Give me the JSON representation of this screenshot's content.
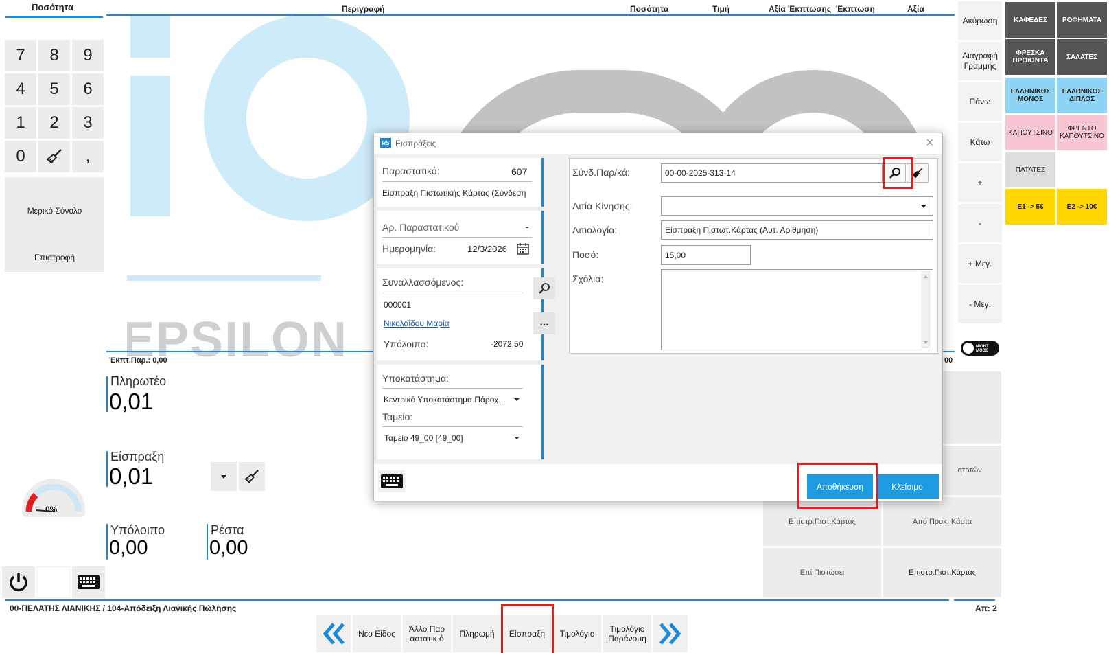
{
  "header": {
    "quantity_left": "Ποσότητα",
    "description": "Περιγραφή",
    "quantity": "Ποσότητα",
    "price": "Τιμή",
    "discount_value": "Αξία Έκπτωσης",
    "discount": "Έκπτωση",
    "value": "Αξία"
  },
  "numpad": {
    "keys": [
      "7",
      "8",
      "9",
      "4",
      "5",
      "6",
      "1",
      "2",
      "3",
      "0",
      ","
    ],
    "partial_total": "Μερικό Σύνολο",
    "return": "Επιστροφή"
  },
  "right_menu": [
    "Ακύρωση",
    "Διαγραφή Γραμμής",
    "Πάνω",
    "Κάτω",
    "+",
    "-",
    "+ Μεγ.",
    "- Μεγ."
  ],
  "night_mode": "NIGHT MODE",
  "categories": [
    {
      "label": "ΚΑΦΕΔΕΣ",
      "bg": "#555555",
      "fg": "#ffffff"
    },
    {
      "label": "ΡΟΦΗΜΑΤΑ",
      "bg": "#555555",
      "fg": "#ffffff"
    },
    {
      "label": "ΦΡΕΣΚΑ ΠΡΟΙΟΝΤΑ",
      "bg": "#555555",
      "fg": "#ffffff"
    },
    {
      "label": "ΣΑΛΑΤΕΣ",
      "bg": "#555555",
      "fg": "#ffffff"
    },
    {
      "label": "ΕΛΛΗΝΙΚΟΣ ΜΟΝΟΣ",
      "bg": "#8fd3f4",
      "fg": "#222222"
    },
    {
      "label": "ΕΛΛΗΝΙΚΟΣ ΔΙΠΛΟΣ",
      "bg": "#8fd3f4",
      "fg": "#222222"
    },
    {
      "label": "ΚΑΠΟΥΤΣΙΝΟ",
      "bg": "#f8c6d2",
      "fg": "#222222"
    },
    {
      "label": "ΦΡΕΝΤΟ ΚΑΠΟΥΤΣΙΝΟ",
      "bg": "#f8c6d2",
      "fg": "#222222"
    },
    {
      "label": "ΠΑΤΑΤΕΣ",
      "bg": "#dedede",
      "fg": "#222222"
    },
    {
      "label": "E1 -> 5€",
      "bg": "#ffd700",
      "fg": "#222222"
    },
    {
      "label": "E2 -> 10€",
      "bg": "#ffd700",
      "fg": "#222222"
    }
  ],
  "summary": {
    "discount_param": "Έκπτ.Παρ.: 0,00",
    "right_value": "00",
    "payable_label": "Πληρωτέο",
    "payable_value": "0,01",
    "receipt_label": "Είσπραξη",
    "receipt_value": "0,01",
    "balance_label": "Υπόλοιπο",
    "balance_value": "0,00",
    "change_label": "Ρέστα",
    "change_value": "0,00",
    "gauge_percent": "0%"
  },
  "background": {
    "logo_text": "EPSILON"
  },
  "payment_grid": {
    "partial_label": "στρτών",
    "card_return": "Επιστρ.Πιστ.Κάρτας",
    "from_card": "Από Προκ. Κάρτα",
    "on_credit": "Επί Πιστώσει",
    "card_return_2": "Επιστρ.Πιστ.Κάρτας"
  },
  "footer": {
    "customer": "00-ΠΕΛΑΤΗΣ ΛΙΑΝΙΚΗΣ / 104-Απόδειξη Λιανικής Πώλησης",
    "count": "Απ: 2",
    "buttons": [
      "Νέο Είδος",
      "Άλλο Παραστατικ ό",
      "Πληρωμή",
      "Είσπραξη",
      "Τιμολόγιο",
      "Τιμολόγιο Παράνομη"
    ]
  },
  "dialog": {
    "app_badge": "RS",
    "title": "Εισπράξεις",
    "doc_label": "Παραστατικό:",
    "doc_value": "607",
    "doc_type": "Είσπραξη Πιστωτικής Κάρτας (Σύνδεση",
    "doc_number_label": "Αρ. Παραστατικού",
    "doc_number_value": "-",
    "date_label": "Ημερομηνία:",
    "date_value": "12/3/2026",
    "trader_label": "Συναλλασσόμενος:",
    "trader_code": "000001",
    "trader_name": "Νικολαΐδου Μαρία",
    "trader_balance_label": "Υπόλοιπο:",
    "trader_balance_value": "-2072,50",
    "branch_label": "Υποκατάστημα:",
    "branch_value": "Κεντρικό Υποκατάστημα Πάροχ...",
    "register_label": "Ταμείο:",
    "register_value": "Ταμείο 49_00 [49_00]",
    "linked_label": "Σύνδ.Παρ/κά:",
    "linked_value": "00-00-2025-313-14",
    "reason_label": "Αιτία Κίνησης:",
    "reason_value": "",
    "justification_label": "Αιτιολογία:",
    "justification_value": "Είσπραξη Πιστωτ.Κάρτας (Αυτ. Αρίθμηση)",
    "amount_label": "Ποσό:",
    "amount_value": "15,00",
    "comments_label": "Σχόλια:",
    "comments_value": "",
    "save_label": "Αποθήκευση",
    "close_label": "Κλείσιμο",
    "more_label": "..."
  }
}
